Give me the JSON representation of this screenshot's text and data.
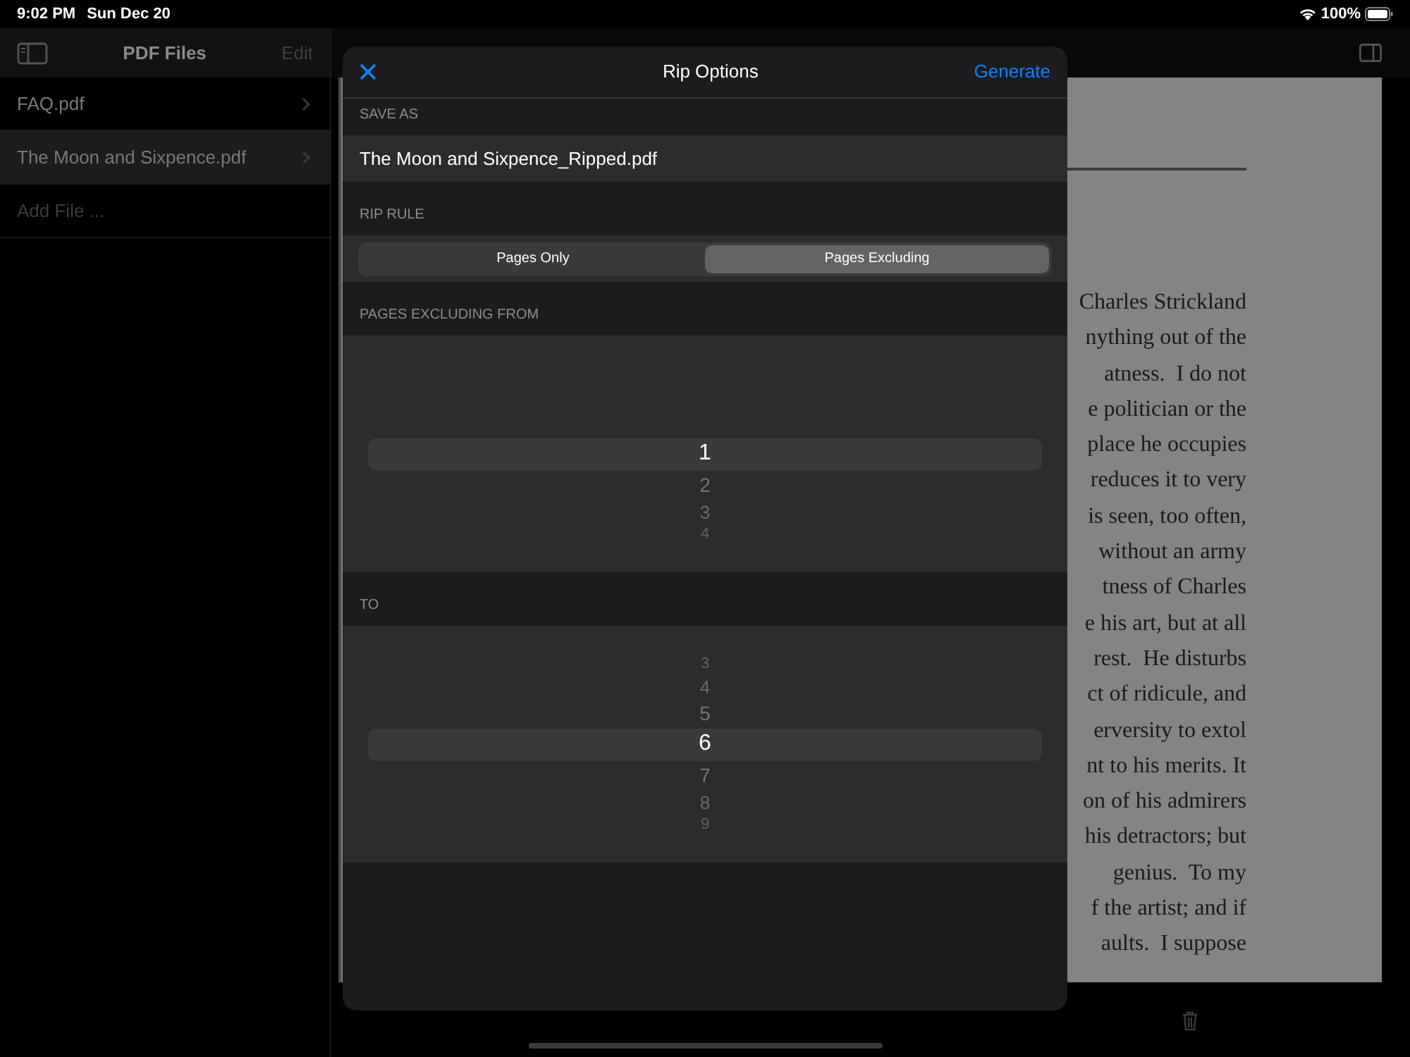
{
  "status_bar": {
    "time": "9:02 PM",
    "date": "Sun Dec 20",
    "battery": "100%"
  },
  "sidebar": {
    "title": "PDF Files",
    "edit": "Edit",
    "items": [
      {
        "label": "FAQ.pdf",
        "selected": false,
        "kind": "file"
      },
      {
        "label": "The Moon and Sixpence.pdf",
        "selected": true,
        "kind": "file"
      },
      {
        "label": "Add File ...",
        "selected": false,
        "kind": "add"
      }
    ]
  },
  "document": {
    "lines": [
      "Charles Strickland",
      "nything out of the",
      "atness.  I do not",
      "e politician or the",
      "place he occupies",
      "reduces it to very",
      "is seen, too often,",
      "without an army",
      "tness of Charles",
      "e his art, but at all",
      "rest.  He disturbs",
      "ct of ridicule, and",
      "erversity to extol",
      "nt to his merits. It",
      "on of his admirers",
      "his detractors; but",
      "genius.  To my",
      "f the artist; and if",
      "aults.  I suppose"
    ]
  },
  "dialog": {
    "title": "Rip Options",
    "action": "Generate",
    "sections": [
      {
        "kind": "field",
        "header": "SAVE AS",
        "value": "The Moon and Sixpence_Ripped.pdf"
      },
      {
        "kind": "segmented",
        "header": "RIP RULE",
        "segments": [
          {
            "label": "Pages Only",
            "selected": false
          },
          {
            "label": "Pages Excluding",
            "selected": true
          }
        ]
      },
      {
        "kind": "picker",
        "header": "PAGES EXCLUDING FROM",
        "items": [
          {
            "label": "1",
            "selected": true
          },
          {
            "label": "2",
            "selected": false
          },
          {
            "label": "3",
            "selected": false
          },
          {
            "label": "4",
            "selected": false
          }
        ]
      },
      {
        "kind": "picker",
        "header": "TO",
        "items": [
          {
            "label": "3",
            "selected": false
          },
          {
            "label": "4",
            "selected": false
          },
          {
            "label": "5",
            "selected": false
          },
          {
            "label": "6",
            "selected": true
          },
          {
            "label": "7",
            "selected": false
          },
          {
            "label": "8",
            "selected": false
          },
          {
            "label": "9",
            "selected": false
          }
        ]
      }
    ]
  }
}
